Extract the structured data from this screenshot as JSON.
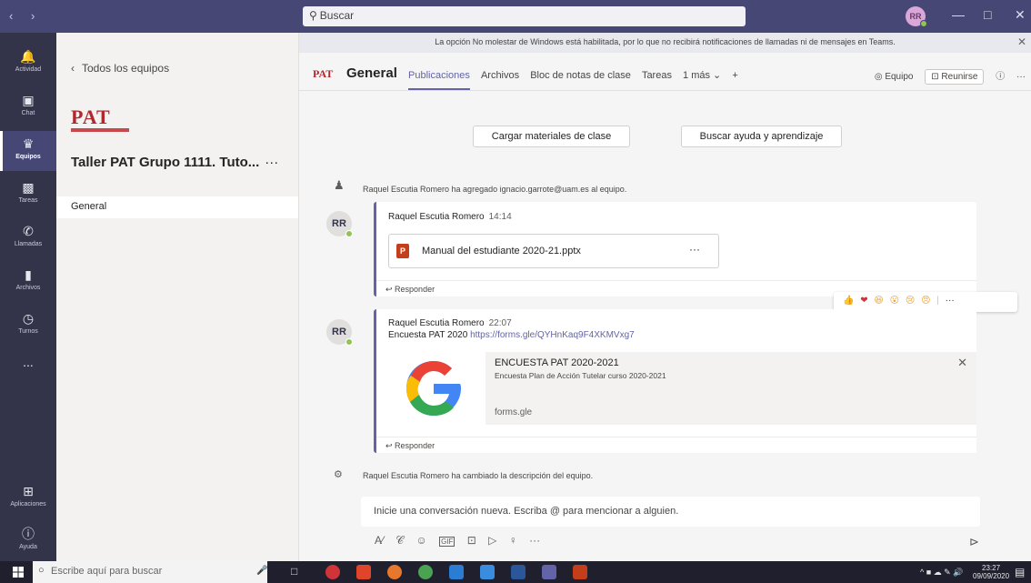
{
  "titlebar": {
    "nav": "‹  ›",
    "search_placeholder": "Buscar",
    "user_initials": "RR"
  },
  "rail": {
    "items": [
      {
        "label": "Actividad",
        "icon": "bell-icon"
      },
      {
        "label": "Chat",
        "icon": "chat-icon"
      },
      {
        "label": "Equipos",
        "icon": "teams-icon"
      },
      {
        "label": "Tareas",
        "icon": "assignments-icon"
      },
      {
        "label": "Llamadas",
        "icon": "phone-icon"
      },
      {
        "label": "Archivos",
        "icon": "files-icon"
      },
      {
        "label": "Turnos",
        "icon": "shifts-icon"
      }
    ],
    "more": "...",
    "apps_label": "Aplicaciones",
    "help_label": "Ayuda"
  },
  "teampane": {
    "back_label": "Todos los equipos",
    "logo_text": "PAT",
    "team_name": "Taller PAT Grupo 1111. Tuto...",
    "team_more": "···",
    "channel": "General"
  },
  "banner": {
    "text": "La opción No molestar de Windows está habilitada, por lo que no recibirá notificaciones de llamadas ni de mensajes en Teams."
  },
  "channel_header": {
    "logo": "PAT",
    "title": "General",
    "tabs": [
      "Publicaciones",
      "Archivos",
      "Bloc de notas de clase",
      "Tareas",
      "1 más ⌄",
      "+"
    ],
    "team_button": "◎ Equipo",
    "meet_button": "⊡ Reunirse",
    "info": "ⓘ",
    "more": "···"
  },
  "actions": {
    "upload": "Cargar materiales de clase",
    "help": "Buscar ayuda y aprendizaje"
  },
  "feed": {
    "sys1": "Raquel Escutia Romero ha agregado ignacio.garrote@uam.es al equipo.",
    "msg1": {
      "initials": "RR",
      "author": "Raquel Escutia Romero",
      "time": "14:14",
      "file_name": "Manual del estudiante 2020-21.pptx",
      "file_more": "···",
      "reply": "↩ Responder"
    },
    "reactions": [
      "👍",
      "❤",
      "😆",
      "😮",
      "😢",
      "😠",
      "|",
      "···"
    ],
    "msg2": {
      "initials": "RR",
      "author": "Raquel Escutia Romero",
      "time": "22:07",
      "text": "Encuesta PAT 2020",
      "link": "https://forms.gle/QYHnKaq9F4XKMVxg7",
      "preview_title": "ENCUESTA PAT 2020-2021",
      "preview_desc": "Encuesta Plan de Acción Tutelar curso 2020-2021",
      "preview_url": "forms.gle",
      "reply": "↩ Responder"
    },
    "sys2_author": "Raquel Escutia Romero",
    "sys2_text": " ha cambiado la descripción del equipo."
  },
  "compose": {
    "placeholder": "Inicie una conversación nueva. Escriba @ para mencionar a alguien.",
    "tools": [
      "A⁄",
      "𝒞",
      "☺",
      "GIF",
      "⊡",
      "▷",
      "♀",
      "···"
    ],
    "send": "⊳"
  },
  "taskbar": {
    "search_placeholder": "Escribe aquí para buscar",
    "time": "23:27",
    "date": "09/09/2020"
  },
  "colors": {
    "titlebar": "#464775",
    "rail": "#33344a",
    "accent": "#6264a7",
    "pat_red": "#b1272e"
  }
}
